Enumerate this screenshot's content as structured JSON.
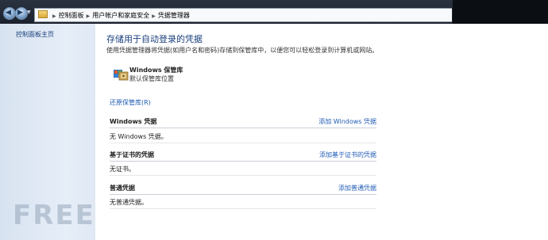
{
  "address_bar": {
    "crumbs": [
      "控制面板",
      "用户帐户和家庭安全",
      "凭据管理器"
    ]
  },
  "left_pane": {
    "home_link": "控制面板主页"
  },
  "main": {
    "title": "存储用于自动登录的凭据",
    "description": "使用凭据管理器将凭据(如用户名和密码)存储到保管库中，以便您可以轻松登录到计算机或网站。",
    "vault": {
      "title": "Windows 保管库",
      "subtitle": "默认保管库位置"
    },
    "restore_link": "还原保管库(R)",
    "sections": [
      {
        "title": "Windows 凭据",
        "add_link": "添加 Windows 凭据",
        "empty_text": "无 Windows 凭据。"
      },
      {
        "title": "基于证书的凭据",
        "add_link": "添加基于证书的凭据",
        "empty_text": "无证书。"
      },
      {
        "title": "普通凭据",
        "add_link": "添加普通凭据",
        "empty_text": "无普通凭据。"
      }
    ]
  },
  "watermark": "FREEBUF",
  "colors": {
    "link": "#1f5bb5",
    "title": "#1a3f7d",
    "leftpane": "#e0e9f5",
    "topbar": "#232a35"
  },
  "icons": [
    "back-arrow-icon",
    "forward-arrow-icon",
    "folder-icon",
    "vault-icon"
  ]
}
